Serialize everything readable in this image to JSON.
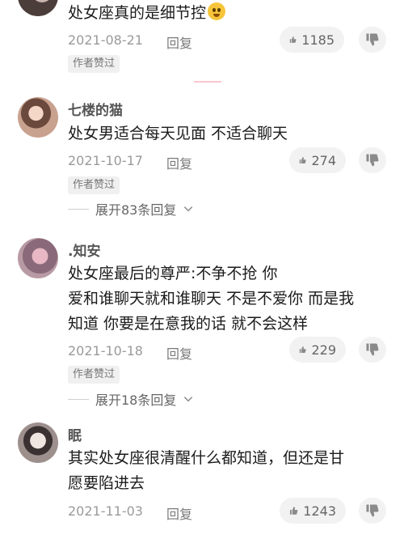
{
  "comments": [
    {
      "text": "处女座真的是细节控",
      "date": "2021-08-21",
      "reply_label": "回复",
      "likes": "1185",
      "badge": "作者赞过"
    },
    {
      "name": "七楼的猫",
      "text": "处女男适合每天见面 不适合聊天",
      "date": "2021-10-17",
      "reply_label": "回复",
      "likes": "274",
      "badge": "作者赞过",
      "expand": "展开83条回复"
    },
    {
      "name": ".知安",
      "text_lines": [
        "处女座最后的尊严:不争不抢 你",
        "爱和谁聊天就和谁聊天 不是不爱你 而是我",
        "知道 你要是在意我的话 就不会这样"
      ],
      "date": "2021-10-18",
      "reply_label": "回复",
      "likes": "229",
      "badge": "作者赞过",
      "expand": "展开18条回复"
    },
    {
      "name": "眠",
      "text_lines": [
        "其实处女座很清醒什么都知道，但还是甘",
        "愿要陷进去"
      ],
      "date": "2021-11-03",
      "reply_label": "回复",
      "likes": "1243"
    }
  ],
  "icons": {
    "like": "thumbs-up-icon",
    "dislike": "thumbs-down-icon",
    "expand": "chevron-down-icon",
    "emoji": "smiling-face-emoji-icon"
  },
  "colors": {
    "accent_pink": "#f7c6d0",
    "muted": "#9a9a9a"
  }
}
